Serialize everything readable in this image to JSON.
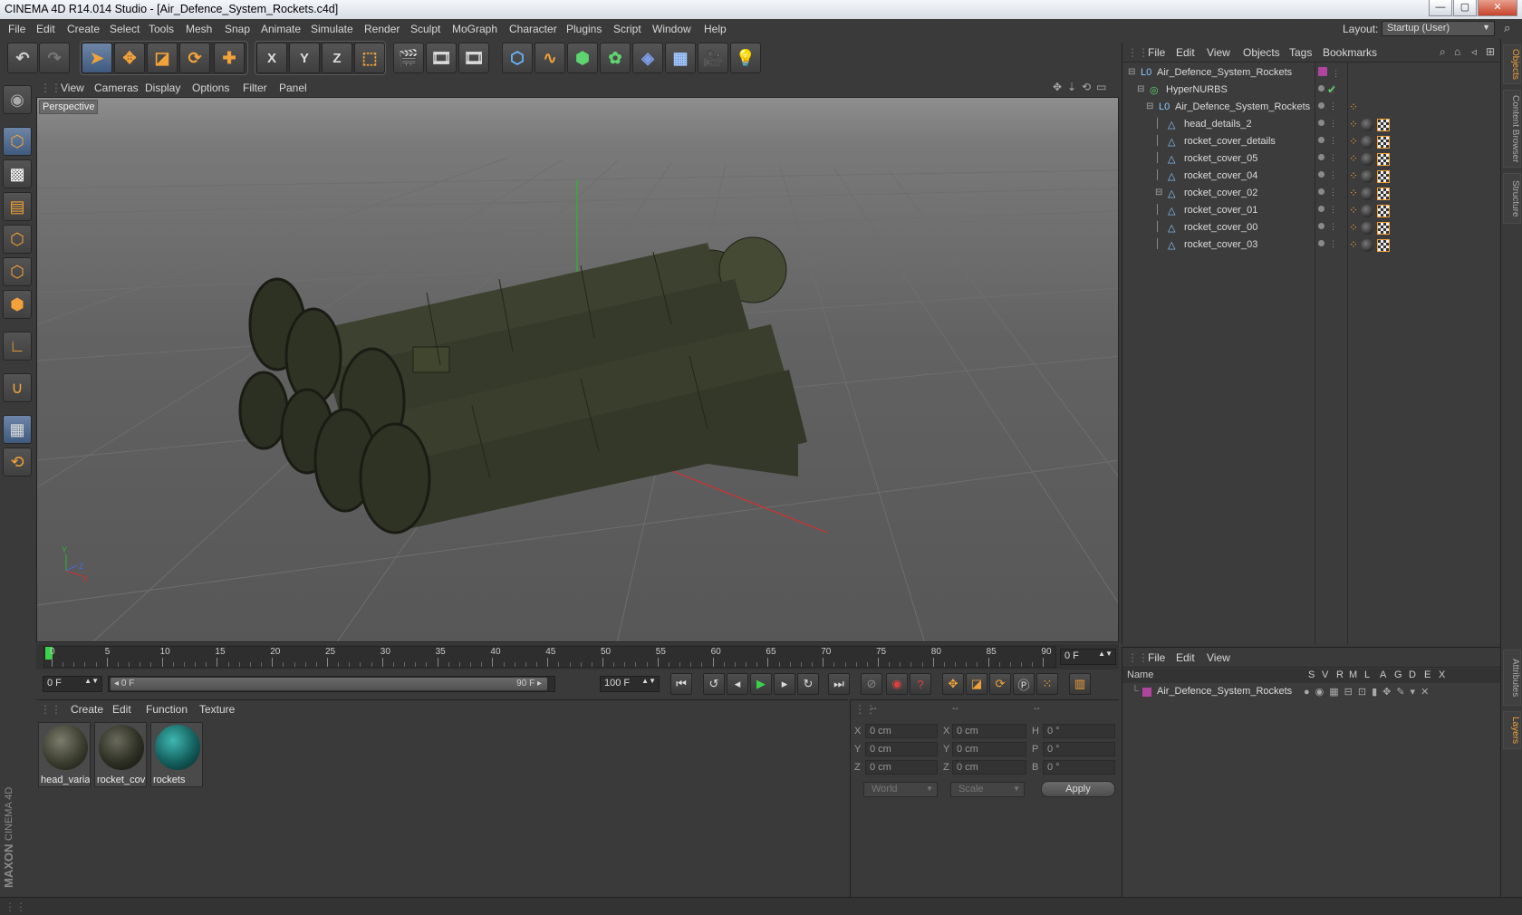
{
  "window": {
    "title": "CINEMA 4D R14.014 Studio - [Air_Defence_System_Rockets.c4d]"
  },
  "menubar": [
    "File",
    "Edit",
    "Create",
    "Select",
    "Tools",
    "Mesh",
    "Snap",
    "Animate",
    "Simulate",
    "Render",
    "Sculpt",
    "MoGraph",
    "Character",
    "Plugins",
    "Script",
    "Window",
    "Help"
  ],
  "layout": {
    "label": "Layout:",
    "value": "Startup (User)"
  },
  "toolbar": {
    "axes": [
      "X",
      "Y",
      "Z"
    ]
  },
  "viewport": {
    "menus": [
      "View",
      "Cameras",
      "Display",
      "Options",
      "Filter",
      "Panel"
    ],
    "label": "Perspective",
    "axis_labels": [
      "Y",
      "X",
      "Z"
    ]
  },
  "timeline": {
    "ticks": [
      "0",
      "5",
      "10",
      "15",
      "20",
      "25",
      "30",
      "35",
      "40",
      "45",
      "50",
      "55",
      "60",
      "65",
      "70",
      "75",
      "80",
      "85",
      "90"
    ],
    "current_frame": "0 F",
    "start_field": "0 F",
    "range_start": "0 F",
    "range_end": "90 F",
    "end_field": "100 F"
  },
  "material_panel": {
    "menus": [
      "Create",
      "Edit",
      "Function",
      "Texture"
    ],
    "materials": [
      {
        "name": "head_varia"
      },
      {
        "name": "rocket_cov"
      },
      {
        "name": "rockets"
      }
    ]
  },
  "coordinates": {
    "header": [
      "--",
      "--",
      "--"
    ],
    "rows": [
      {
        "a": "X",
        "a_val": "0 cm",
        "b": "X",
        "b_val": "0 cm",
        "c": "H",
        "c_val": "0 °"
      },
      {
        "a": "Y",
        "a_val": "0 cm",
        "b": "Y",
        "b_val": "0 cm",
        "c": "P",
        "c_val": "0 °"
      },
      {
        "a": "Z",
        "a_val": "0 cm",
        "b": "Z",
        "b_val": "0 cm",
        "c": "B",
        "c_val": "0 °"
      }
    ],
    "mode": "World",
    "type": "Scale",
    "apply": "Apply"
  },
  "object_manager": {
    "menus": [
      "File",
      "Edit",
      "View",
      "Objects",
      "Tags",
      "Bookmarks"
    ],
    "objects": [
      {
        "name": "Air_Defence_System_Rockets",
        "indent": 0,
        "type": "null"
      },
      {
        "name": "HyperNURBS",
        "indent": 1,
        "type": "nurbs"
      },
      {
        "name": "Air_Defence_System_Rockets",
        "indent": 2,
        "type": "null"
      },
      {
        "name": "head_details_2",
        "indent": 3,
        "type": "poly"
      },
      {
        "name": "rocket_cover_details",
        "indent": 3,
        "type": "poly"
      },
      {
        "name": "rocket_cover_05",
        "indent": 3,
        "type": "poly"
      },
      {
        "name": "rocket_cover_04",
        "indent": 3,
        "type": "poly"
      },
      {
        "name": "rocket_cover_02",
        "indent": 3,
        "type": "poly"
      },
      {
        "name": "rocket_cover_01",
        "indent": 3,
        "type": "poly"
      },
      {
        "name": "rocket_cover_00",
        "indent": 3,
        "type": "poly"
      },
      {
        "name": "rocket_cover_03",
        "indent": 3,
        "type": "poly"
      }
    ]
  },
  "layer_manager": {
    "menus": [
      "File",
      "Edit",
      "View"
    ],
    "columns": [
      "Name",
      "S",
      "V",
      "R",
      "M",
      "L",
      "A",
      "G",
      "D",
      "E",
      "X"
    ],
    "layers": [
      {
        "name": "Air_Defence_System_Rockets"
      }
    ]
  },
  "side_tabs": [
    "Objects",
    "Content Browser",
    "Structure",
    "Attributes",
    "Layers"
  ],
  "brand": {
    "maxon": "MAXON",
    "product": "CINEMA 4D"
  },
  "colors": {
    "accent": "#5b7fb0",
    "layer": "#b0459e",
    "x_axis": "#d03030",
    "y_axis": "#30c030"
  }
}
